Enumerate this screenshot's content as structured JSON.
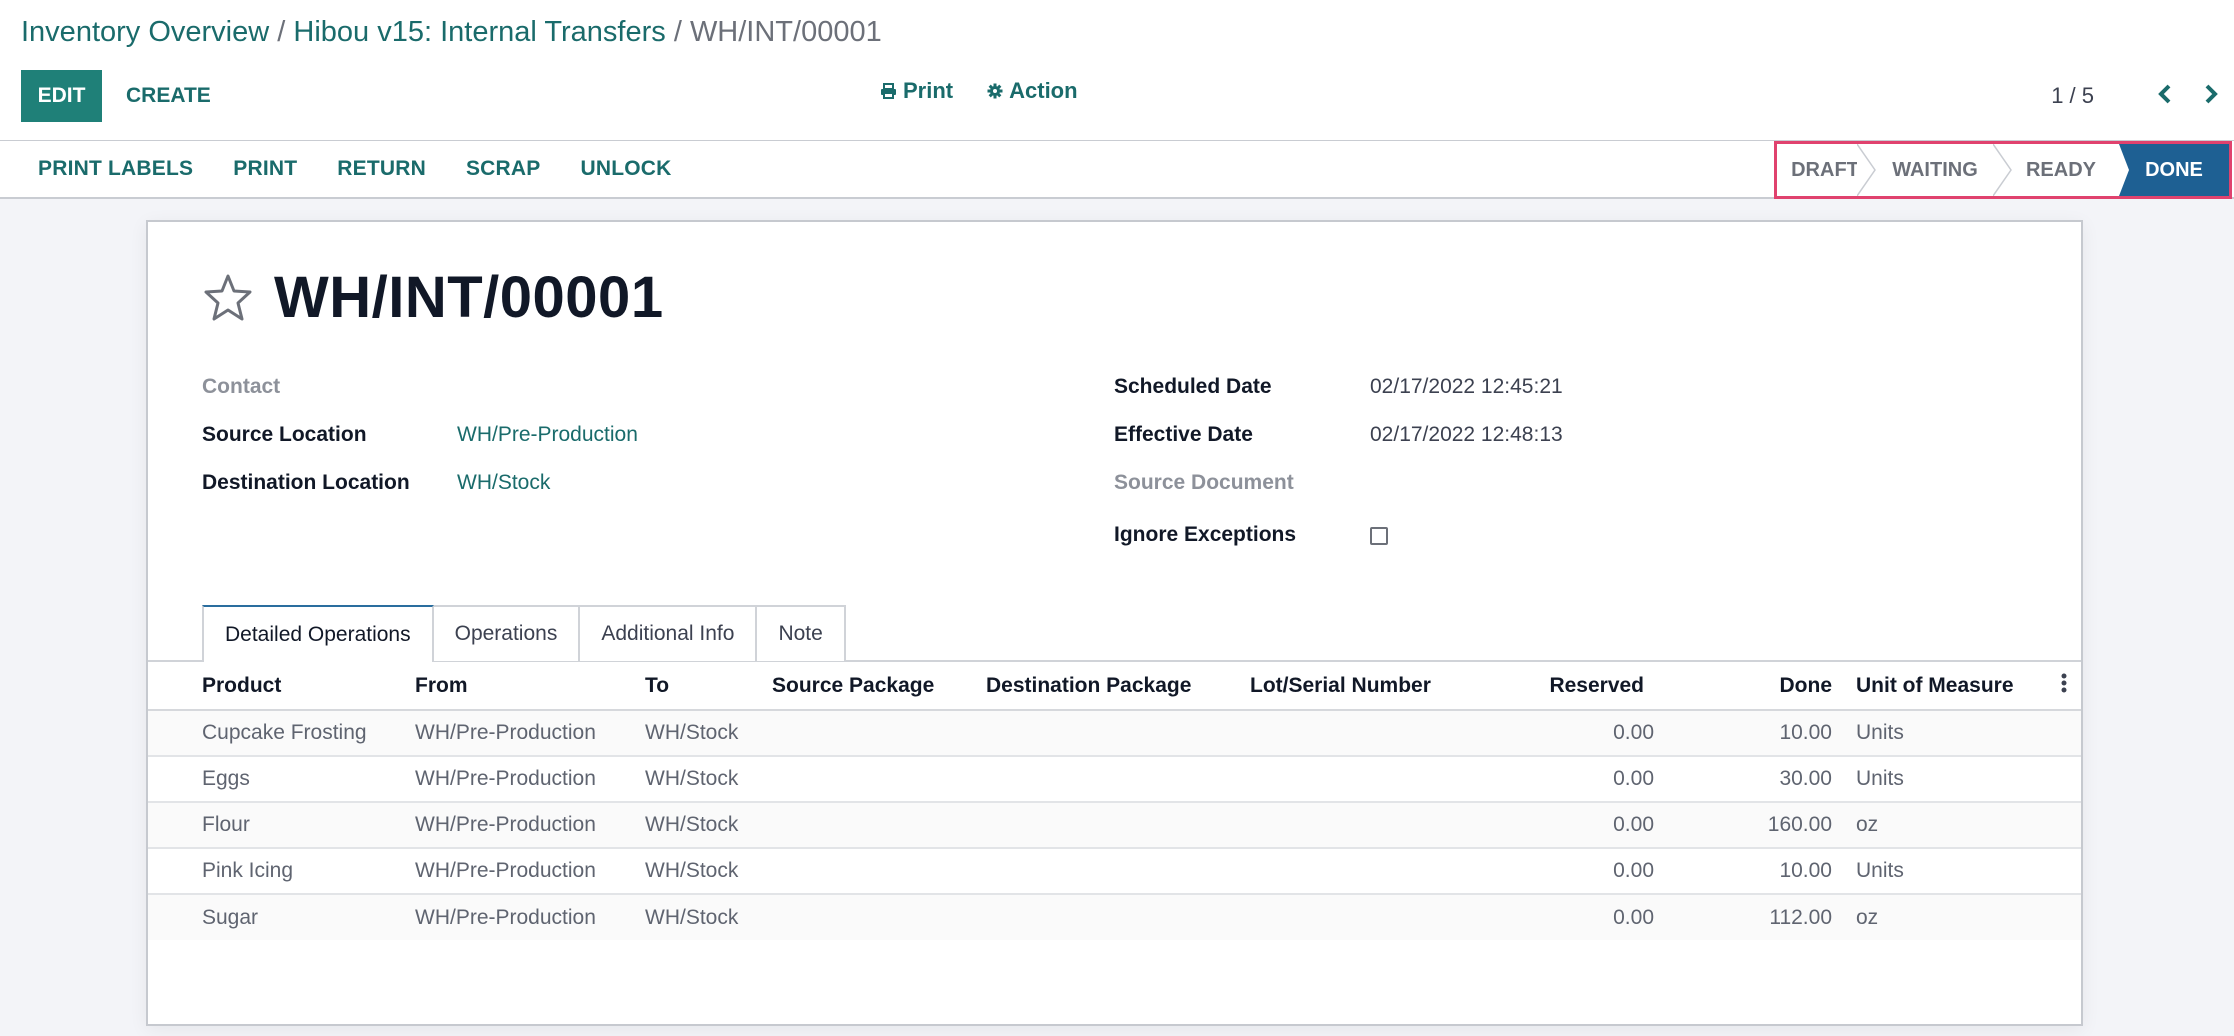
{
  "breadcrumb": {
    "items": [
      "Inventory Overview",
      "Hibou v15: Internal Transfers"
    ],
    "separator": "/",
    "current": "WH/INT/00001"
  },
  "toolbar": {
    "edit_label": "EDIT",
    "create_label": "CREATE",
    "print_label": "Print",
    "print_icon": "printer-icon",
    "action_label": "Action",
    "action_icon": "gear-icon"
  },
  "pager": {
    "value": "1 / 5",
    "prev_icon": "chevron-left-icon",
    "next_icon": "chevron-right-icon"
  },
  "header_buttons": [
    "PRINT LABELS",
    "PRINT",
    "RETURN",
    "SCRAP",
    "UNLOCK"
  ],
  "statusbar": {
    "steps": [
      "DRAFT",
      "WAITING",
      "READY",
      "DONE"
    ],
    "current": "DONE",
    "active_color": "#1e6093",
    "highlight_color": "#e0426e"
  },
  "record": {
    "title": "WH/INT/00001",
    "favorite": false,
    "left_fields": [
      {
        "label": "Contact",
        "value": "",
        "muted": true
      },
      {
        "label": "Source Location",
        "value": "WH/Pre-Production"
      },
      {
        "label": "Destination Location",
        "value": "WH/Stock"
      }
    ],
    "right_fields": [
      {
        "label": "Scheduled Date",
        "value": "02/17/2022 12:45:21"
      },
      {
        "label": "Effective Date",
        "value": "02/17/2022 12:48:13"
      },
      {
        "label": "Source Document",
        "value": "",
        "muted": true
      },
      {
        "label": "Ignore Exceptions",
        "checked": false
      }
    ]
  },
  "tabs": [
    {
      "label": "Detailed Operations",
      "active": true
    },
    {
      "label": "Operations"
    },
    {
      "label": "Additional Info"
    },
    {
      "label": "Note"
    }
  ],
  "table": {
    "columns": [
      "Product",
      "From",
      "To",
      "Source Package",
      "Destination Package",
      "Lot/Serial Number",
      "Reserved",
      "Done",
      "Unit of Measure"
    ],
    "rows": [
      [
        "Cupcake Frosting",
        "WH/Pre-Production",
        "WH/Stock",
        "",
        "",
        "",
        "0.00",
        "10.00",
        "Units"
      ],
      [
        "Eggs",
        "WH/Pre-Production",
        "WH/Stock",
        "",
        "",
        "",
        "0.00",
        "30.00",
        "Units"
      ],
      [
        "Flour",
        "WH/Pre-Production",
        "WH/Stock",
        "",
        "",
        "",
        "0.00",
        "160.00",
        "oz"
      ],
      [
        "Pink Icing",
        "WH/Pre-Production",
        "WH/Stock",
        "",
        "",
        "",
        "0.00",
        "10.00",
        "Units"
      ],
      [
        "Sugar",
        "WH/Pre-Production",
        "WH/Stock",
        "",
        "",
        "",
        "0.00",
        "112.00",
        "oz"
      ]
    ]
  },
  "colors": {
    "brand": "#1f8078",
    "link": "#1a6b6b",
    "status_done": "#1e6093"
  }
}
